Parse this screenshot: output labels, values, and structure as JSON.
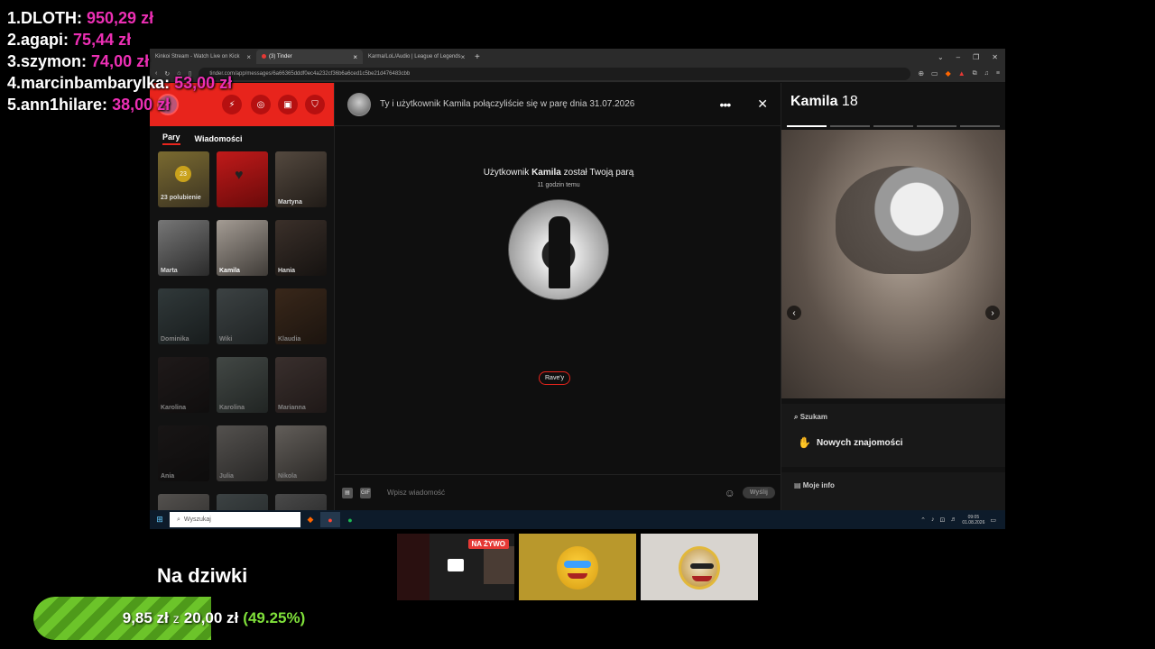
{
  "leaderboard": [
    {
      "rank": "1.",
      "name": "DLOTH:",
      "amount": "950,29 zł"
    },
    {
      "rank": "2.",
      "name": "agapi:",
      "amount": "75,44 zł"
    },
    {
      "rank": "3.",
      "name": "szymon:",
      "amount": "74,00 zł"
    },
    {
      "rank": "4.",
      "name": "marcinbambarylka:",
      "amount": "53,00 zł"
    },
    {
      "rank": "5.",
      "name": "ann1hilare:",
      "amount": "38,00 zł"
    }
  ],
  "browser": {
    "tabs": [
      {
        "label": "Kinkoi Stream - Watch Live on Kick"
      },
      {
        "label": "(3) Tinder"
      },
      {
        "label": "Karma/LoL/Audio | League of Legends"
      }
    ],
    "url": "tinder.com/app/messages/6a66365dddf0ec4a232cf36b6a6ced1c5be21d476483cbb"
  },
  "sidebar": {
    "tabs": [
      "Pary",
      "Wiadomości"
    ],
    "likes_count": "23",
    "likes_label": "23 polubienie",
    "matches": [
      "Martyna",
      "Marta",
      "Kamila",
      "Hania",
      "Dominika",
      "Wiki",
      "Klaudia",
      "Karolina",
      "Karolina",
      "Marianna",
      "Ania",
      "Julia",
      "Nikola"
    ]
  },
  "chat": {
    "header_text": "Ty i użytkownik Kamila połączyliście się w parę dnia 31.07.2026",
    "match_prefix": "Użytkownik",
    "match_name": "Kamila",
    "match_suffix": "został Twoją parą",
    "match_time": "11 godzin temu",
    "tag": "Rave'y",
    "composer_placeholder": "Wpisz wiadomość",
    "gif_label": "GIF",
    "send_label": "Wyślij"
  },
  "profile": {
    "name": "Kamila",
    "age": "18",
    "photo_count": 5,
    "active_photo": 1,
    "looking_label": "Szukam",
    "looking_value": "Nowych znajomości",
    "info_label": "Moje info"
  },
  "taskbar": {
    "search_label": "Wyszukaj",
    "time": "09:05",
    "date": "01.08.2026"
  },
  "goal": {
    "title": "Na dziwki",
    "current": "9,85 zł",
    "sep": "z",
    "target": "20,00 zł",
    "percent_label": "(49.25%)",
    "percent": 49.25
  },
  "thumbnails": {
    "live_badge": "NA ŻYWO"
  }
}
